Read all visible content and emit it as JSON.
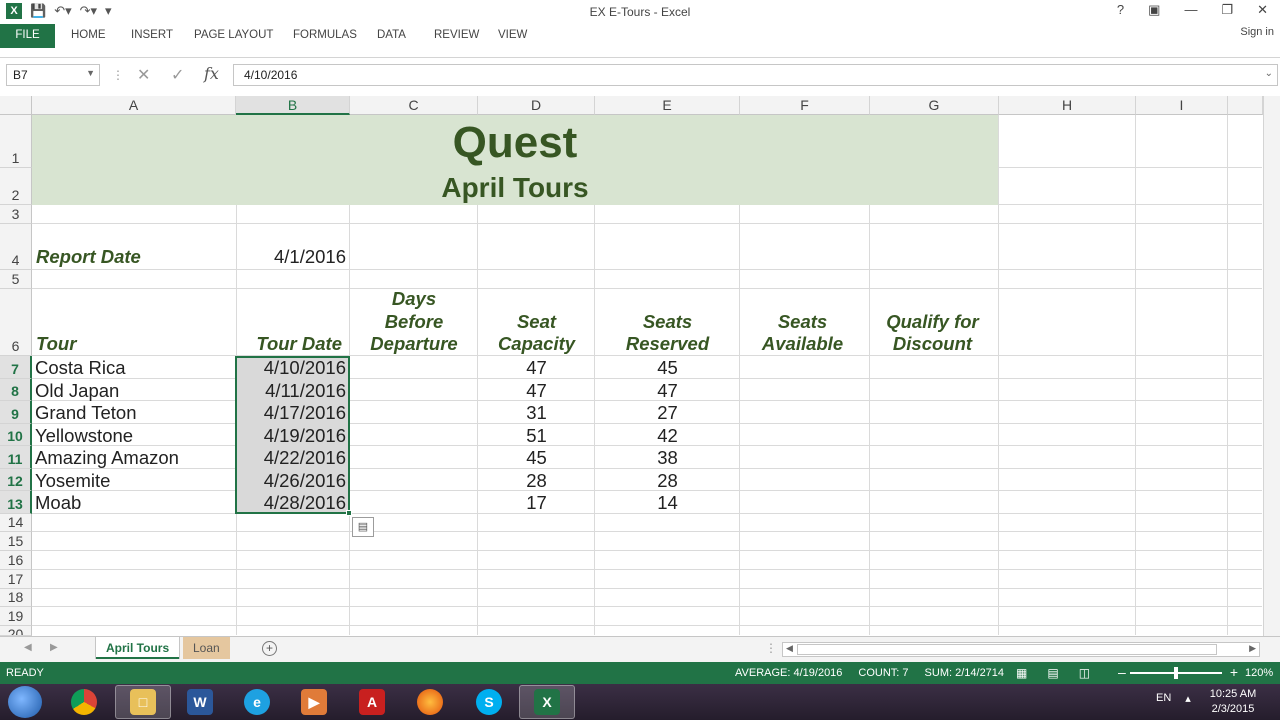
{
  "window": {
    "title": "EX E-Tours - Excel",
    "help": "?",
    "sign_in": "Sign in"
  },
  "ribbon": {
    "tabs": [
      "FILE",
      "HOME",
      "INSERT",
      "PAGE LAYOUT",
      "FORMULAS",
      "DATA",
      "REVIEW",
      "VIEW"
    ]
  },
  "formula_bar": {
    "name_box": "B7",
    "formula": "4/10/2016",
    "fx": "fx"
  },
  "columns": [
    "A",
    "B",
    "C",
    "D",
    "E",
    "F",
    "G",
    "H",
    "I"
  ],
  "rows": [
    "1",
    "2",
    "3",
    "4",
    "5",
    "6",
    "7",
    "8",
    "9",
    "10",
    "11",
    "12",
    "13",
    "14",
    "15",
    "16",
    "17",
    "18",
    "19",
    "20"
  ],
  "sheet": {
    "title": "Quest",
    "subtitle": "April Tours",
    "report_date_label": "Report Date",
    "report_date_value": "4/1/2016",
    "headers": {
      "tour": "Tour",
      "tour_date": "Tour Date",
      "days_before_1": "Days",
      "days_before_2": "Before",
      "days_before_3": "Departure",
      "seat_capacity_1": "Seat",
      "seat_capacity_2": "Capacity",
      "seats_reserved_1": "Seats",
      "seats_reserved_2": "Reserved",
      "seats_available_1": "Seats",
      "seats_available_2": "Available",
      "qualify_1": "Qualify for",
      "qualify_2": "Discount"
    },
    "tours": [
      {
        "tour": "Costa Rica",
        "date": "4/10/2016",
        "capacity": "47",
        "reserved": "45"
      },
      {
        "tour": "Old Japan",
        "date": "4/11/2016",
        "capacity": "47",
        "reserved": "47"
      },
      {
        "tour": "Grand Teton",
        "date": "4/17/2016",
        "capacity": "31",
        "reserved": "27"
      },
      {
        "tour": "Yellowstone",
        "date": "4/19/2016",
        "capacity": "51",
        "reserved": "42"
      },
      {
        "tour": "Amazing Amazon",
        "date": "4/22/2016",
        "capacity": "45",
        "reserved": "38"
      },
      {
        "tour": "Yosemite",
        "date": "4/26/2016",
        "capacity": "28",
        "reserved": "28"
      },
      {
        "tour": "Moab",
        "date": "4/28/2016",
        "capacity": "17",
        "reserved": "14"
      }
    ]
  },
  "sheet_tabs": {
    "active": "April Tours",
    "other": "Loan"
  },
  "status": {
    "ready": "READY",
    "average": "AVERAGE: 4/19/2016",
    "count": "COUNT: 7",
    "sum": "SUM: 2/14/2714",
    "zoom": "120%"
  },
  "taskbar": {
    "lang": "EN",
    "time": "10:25 AM",
    "date": "2/3/2015"
  },
  "colors": {
    "excel_green": "#217346",
    "title_green": "#375623",
    "banner": "#d8e4d1"
  }
}
